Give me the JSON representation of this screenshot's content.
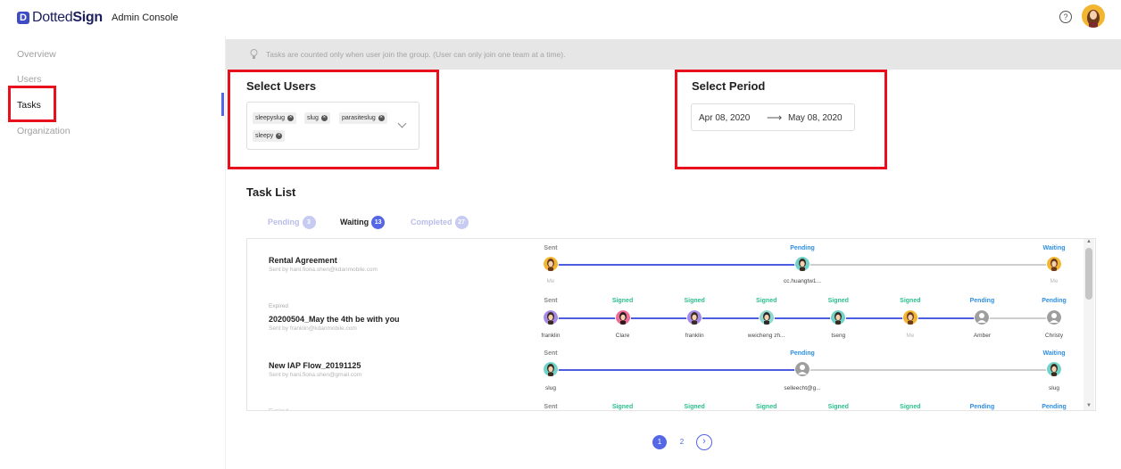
{
  "header": {
    "logo_mark": "D",
    "logo_text_light": "Dotted",
    "logo_text_bold": "Sign",
    "console_label": "Admin Console",
    "help_glyph": "?",
    "avatar_icon": "user-avatar"
  },
  "sidebar": {
    "items": [
      {
        "label": "Overview",
        "active": false
      },
      {
        "label": "Users",
        "active": false
      },
      {
        "label": "Tasks",
        "active": true
      },
      {
        "label": "Organization",
        "active": false
      }
    ]
  },
  "notice": {
    "icon": "lightbulb-icon",
    "text": "Tasks are counted only when user join the group. (User can only join one team at a time)."
  },
  "select_users": {
    "title": "Select Users",
    "chips": [
      "sleepyslug",
      "slug",
      "parasiteslug",
      "sleepy"
    ],
    "remove_glyph": "×"
  },
  "select_period": {
    "title": "Select Period",
    "start": "Apr 08, 2020",
    "arrow": "⟶",
    "end": "May 08, 2020"
  },
  "task_list": {
    "title": "Task List",
    "tabs": [
      {
        "label": "Pending",
        "count": "3",
        "active": false
      },
      {
        "label": "Waiting",
        "count": "13",
        "active": true
      },
      {
        "label": "Completed",
        "count": "27",
        "active": false
      }
    ],
    "tasks": [
      {
        "status": "",
        "title": "Rental Agreement",
        "sender": "Sent by hani.fiona.shen@kdanmobile.com",
        "steps": [
          {
            "status": "Sent",
            "name": "Me",
            "avatar": "female-orange"
          },
          {
            "status": "Pending",
            "name": "cc.huangtw1...",
            "avatar": "male-teal"
          },
          {
            "status": "Waiting",
            "name": "Me",
            "avatar": "female-orange"
          }
        ]
      },
      {
        "status": "Expired",
        "title": "20200504_May the 4th be with you",
        "sender": "Sent by franklin@kdanmobile.com",
        "steps": [
          {
            "status": "Sent",
            "name": "franklin",
            "avatar": "male-purple"
          },
          {
            "status": "Signed",
            "name": "Clare",
            "avatar": "female-pink"
          },
          {
            "status": "Signed",
            "name": "franklin",
            "avatar": "male-purple"
          },
          {
            "status": "Signed",
            "name": "weicheng zh...",
            "avatar": "male-glasses"
          },
          {
            "status": "Signed",
            "name": "tseng",
            "avatar": "male-teal"
          },
          {
            "status": "Signed",
            "name": "Me",
            "avatar": "female-orange"
          },
          {
            "status": "Pending",
            "name": "Amber",
            "avatar": "generic-gray"
          },
          {
            "status": "Pending",
            "name": "Christy",
            "avatar": "generic-gray"
          }
        ]
      },
      {
        "status": "",
        "title": "New IAP Flow_20191125",
        "sender": "Sent by hani.fiona.shen@gmail.com",
        "steps": [
          {
            "status": "Sent",
            "name": "slug",
            "avatar": "male-teal"
          },
          {
            "status": "Pending",
            "name": "selleecht@g...",
            "avatar": "generic-gray"
          },
          {
            "status": "Waiting",
            "name": "slug",
            "avatar": "male-teal"
          }
        ]
      },
      {
        "status": "Expired",
        "title": "",
        "sender": "",
        "steps": [
          {
            "status": "Sent"
          },
          {
            "status": "Signed"
          },
          {
            "status": "Signed"
          },
          {
            "status": "Signed"
          },
          {
            "status": "Signed"
          },
          {
            "status": "Signed"
          },
          {
            "status": "Pending"
          },
          {
            "status": "Pending"
          }
        ]
      }
    ]
  },
  "pagination": {
    "pages": [
      "1",
      "2"
    ],
    "current": "1",
    "next_glyph": "›"
  },
  "colors": {
    "accent": "#5566e6",
    "signed": "#2bbf8f",
    "pending": "#2e8fe0",
    "sent": "#888888",
    "highlight_box": "#e8101c"
  }
}
